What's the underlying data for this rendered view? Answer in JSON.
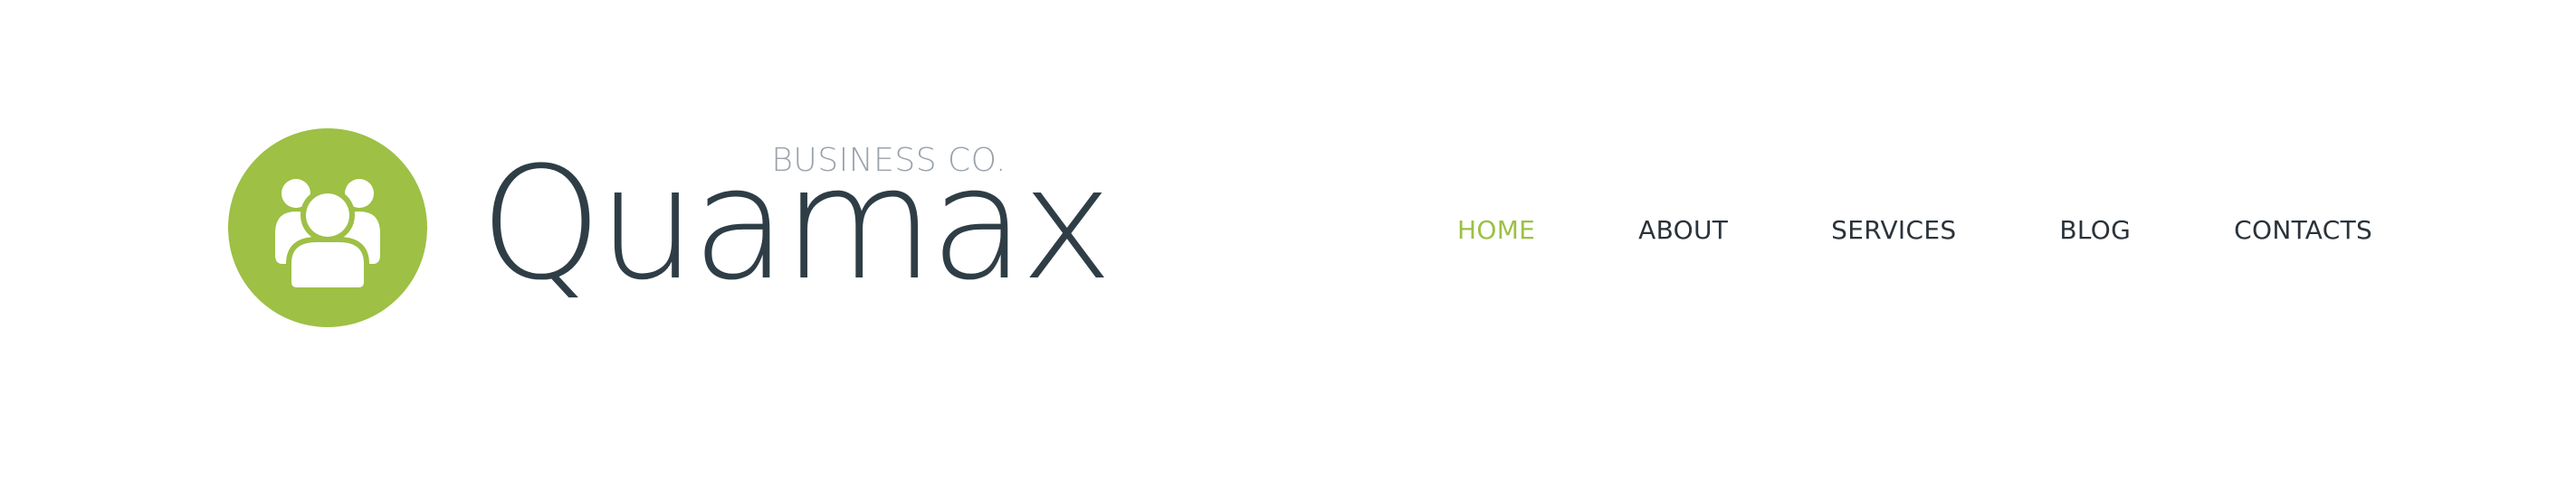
{
  "brand": {
    "tagline": "BUSINESS CO.",
    "name": "Quamax",
    "logo_icon": "group-users-icon",
    "accent_color": "#9dc045",
    "text_color": "#2f3e46",
    "tagline_color": "#9aa2ab"
  },
  "nav": {
    "items": [
      {
        "label": "HOME",
        "active": true
      },
      {
        "label": "ABOUT",
        "active": false
      },
      {
        "label": "SERVICES",
        "active": false
      },
      {
        "label": "BLOG",
        "active": false
      },
      {
        "label": "CONTACTS",
        "active": false
      }
    ],
    "active_color": "#9dc045",
    "default_color": "#2b333a"
  }
}
